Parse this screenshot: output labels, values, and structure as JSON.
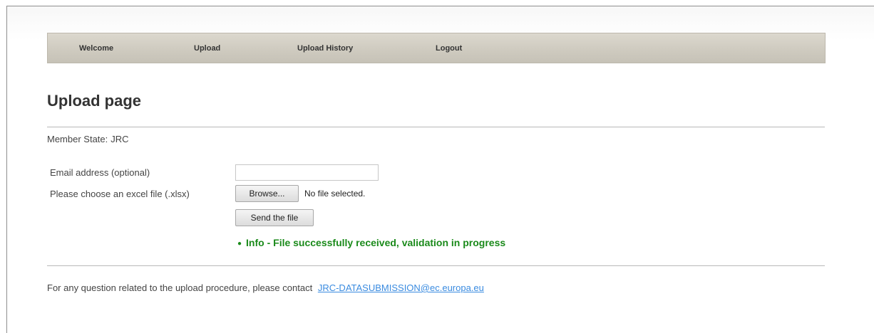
{
  "nav": {
    "items": [
      "Welcome",
      "Upload",
      "Upload History",
      "Logout"
    ]
  },
  "page": {
    "title": "Upload page",
    "member_state_label": "Member State:",
    "member_state_value": "JRC"
  },
  "form": {
    "email_label": "Email address (optional)",
    "email_value": "",
    "file_label": "Please choose an excel file (.xlsx)",
    "browse_label": "Browse...",
    "file_status": "No file selected.",
    "send_label": "Send the file",
    "info_message": "Info - File successfully received, validation in progress",
    "info_color": "#1a8a1a"
  },
  "footer": {
    "contact_text": "For any question related to the upload procedure, please contact",
    "contact_link": "JRC-DATASUBMISSION@ec.europa.eu",
    "link_color": "#3a8be0"
  }
}
